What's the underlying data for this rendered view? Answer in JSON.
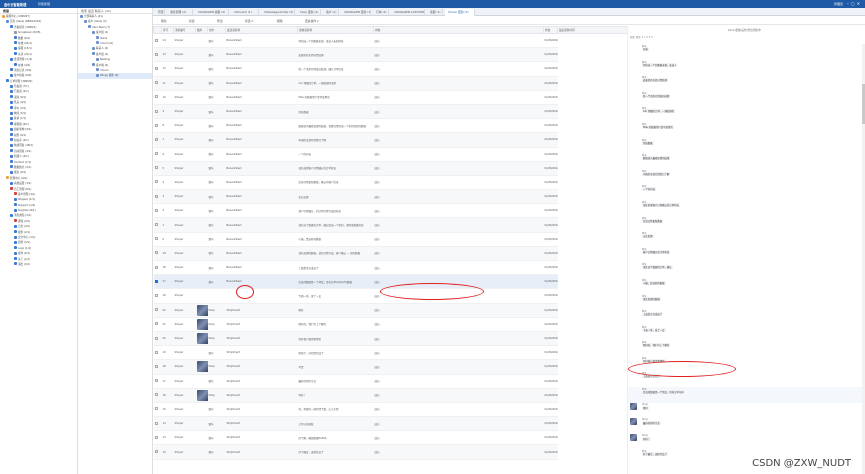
{
  "app": {
    "title": "金尔云智能助理",
    "subtitle": "智能助理",
    "user": "管理员"
  },
  "left": {
    "header": "客服",
    "nodes": [
      {
        "label": "客服中心 (1380/67)",
        "color": "#e8a33a",
        "indent": 0
      },
      {
        "label": "买家 (Vaus) (6869/1234)",
        "color": "#5a8dd6",
        "indent": 1
      },
      {
        "label": "咨询接待 (2068/1)",
        "color": "#3c78d8",
        "indent": 2
      },
      {
        "label": "Scrapbook (40/8)",
        "color": "#999",
        "indent": 3
      },
      {
        "label": "数据 (6/1)",
        "color": "#3c78d8",
        "indent": 3
      },
      {
        "label": "在线 (42/1)",
        "color": "#3c78d8",
        "indent": 3
      },
      {
        "label": "客服 (13/1)",
        "color": "#3c78d8",
        "indent": 3
      },
      {
        "label": "关注 (41/1)",
        "color": "#3c78d8",
        "indent": 3
      },
      {
        "label": "会话管理 (4 /4)",
        "color": "#3c78d8",
        "indent": 2
      },
      {
        "label": "在线 (4/4)",
        "color": "#3c78d8",
        "indent": 3
      },
      {
        "label": "消息记录 (0/0)",
        "color": "#3c78d8",
        "indent": 2
      },
      {
        "label": "客户档案 (6/0)",
        "color": "#3c78d8",
        "indent": 2
      },
      {
        "label": "订单管理 (3960/9)",
        "color": "#3c78d8",
        "indent": 1
      },
      {
        "label": "待发货 (7/1)",
        "color": "#3c78d8",
        "indent": 2
      },
      {
        "label": "已发货 (2/1)",
        "color": "#3c78d8",
        "indent": 2
      },
      {
        "label": "退款 (6/1)",
        "color": "#3c78d8",
        "indent": 2
      },
      {
        "label": "售后 (4/1)",
        "color": "#3c78d8",
        "indent": 2
      },
      {
        "label": "评价 (3/1)",
        "color": "#3c78d8",
        "indent": 2
      },
      {
        "label": "物流 (5/1)",
        "color": "#3c78d8",
        "indent": 2
      },
      {
        "label": "投诉 (1/1)",
        "color": "#3c78d8",
        "indent": 2
      },
      {
        "label": "客服组 (6/1)",
        "color": "#3c78d8",
        "indent": 2
      },
      {
        "label": "组织架构 (9/1)",
        "color": "#3c78d8",
        "indent": 2
      },
      {
        "label": "权限 (6/1)",
        "color": "#3c78d8",
        "indent": 2
      },
      {
        "label": "知识库 (4/1)",
        "color": "#3c78d8",
        "indent": 2
      },
      {
        "label": "快捷回复 (48/1)",
        "color": "#3c78d8",
        "indent": 2
      },
      {
        "label": "自动回复 (4/1)",
        "color": "#3c78d8",
        "indent": 2
      },
      {
        "label": "机器人 (4/1)",
        "color": "#3c78d8",
        "indent": 2
      },
      {
        "label": "Contact (7/1)",
        "color": "#3c78d8",
        "indent": 2
      },
      {
        "label": "数据统计 (2/1)",
        "color": "#3c78d8",
        "indent": 2
      },
      {
        "label": "报表 (9/1)",
        "color": "#3c78d8",
        "indent": 2
      },
      {
        "label": "管理中心 (6/1)",
        "color": "#e8a33a",
        "indent": 1
      },
      {
        "label": "系统设置 (3/1)",
        "color": "#3c78d8",
        "indent": 2
      },
      {
        "label": "员工管理 (8/1)",
        "color": "#d83c3c",
        "indent": 2
      },
      {
        "label": "客户管理 (4/1)",
        "color": "#d83c3c",
        "indent": 3
      },
      {
        "label": "Shipper (1/1)",
        "color": "#3c78d8",
        "indent": 3
      },
      {
        "label": "Support (1/2)",
        "color": "#3c78d8",
        "indent": 3
      },
      {
        "label": "Supplier (6/1)",
        "color": "#3c78d8",
        "indent": 3
      },
      {
        "label": "消息通知 (2/1)",
        "color": "#3c78d8",
        "indent": 2
      },
      {
        "label": "通知 (4/1)",
        "color": "#d83c3c",
        "indent": 3
      },
      {
        "label": "日志 (4/1)",
        "color": "#3c78d8",
        "indent": 3
      },
      {
        "label": "备份 (2/1)",
        "color": "#3c78d8",
        "indent": 3
      },
      {
        "label": "安全中心 (1/1)",
        "color": "#3c78d8",
        "indent": 3
      },
      {
        "label": "更新 (5/1)",
        "color": "#3c78d8",
        "indent": 3
      },
      {
        "label": "Logo (1/1)",
        "color": "#3c78d8",
        "indent": 3
      },
      {
        "label": "插件 (6/1)",
        "color": "#3c78d8",
        "indent": 3
      },
      {
        "label": "关于 (2/1)",
        "color": "#3c78d8",
        "indent": 3
      },
      {
        "label": "退出 (0/1)",
        "color": "#3c78d8",
        "indent": 3
      }
    ]
  },
  "mid": {
    "header": "搜索  最近  联系人  (41)",
    "nodes": [
      {
        "label": "全部联系人 (41)",
        "indent": 0
      },
      {
        "label": "客户 (Vaus) (2)",
        "indent": 1
      },
      {
        "label": "Cars Team (7)",
        "indent": 2
      },
      {
        "label": "客户组 (2)",
        "indent": 3
      },
      {
        "label": "Ibaris",
        "indent": 4
      },
      {
        "label": "Vroom (6)",
        "indent": 4
      },
      {
        "label": "联系人 (4)",
        "indent": 3
      },
      {
        "label": "客户组 (2)",
        "indent": 3
      },
      {
        "label": "Nexting",
        "indent": 4
      },
      {
        "label": "客户端 (4)",
        "indent": 3
      },
      {
        "label": "Vroom",
        "indent": 4
      },
      {
        "label": "Wings 更新 (0)",
        "indent": 4
      }
    ],
    "selected": 11
  },
  "tabs": [
    "首页",
    "消息管理 (4)",
    "VOLWAGEN 客服 (2)",
    "VolCoach (1)",
    "VolkswagenOrder (5)",
    "Shop 更新 (2)",
    "客户 (1)",
    "VOLWAGEN 更新 (3)",
    "订单 (2)",
    "VOLWAGEN CUSTOMS (2)",
    "客服 (1)",
    "Vroom 更新 (3)"
  ],
  "toolbar": [
    "刷新",
    "新建",
    "导出",
    "筛选 ▾",
    "删除",
    "更多操作 ▾"
  ],
  "grid": {
    "headers": [
      "",
      "序号",
      "消息编号",
      "图片",
      "用户",
      "发送者名称",
      "接收者名称",
      "内容",
      "状态",
      "最后更新时间"
    ],
    "rows": [
      {
        "n": "14",
        "id": "Shoper",
        "img": false,
        "from": "赛车",
        "to": "BanersTeam",
        "content": "你的这一个的数据来源。发送人未知消息",
        "status": "成功",
        "time": "01/06/2022 17:48:03"
      },
      {
        "n": "13",
        "id": "Shoper",
        "img": false,
        "from": "赛车",
        "to": "BanersTeam",
        "content": "表面带的东西已经处理",
        "status": "成功",
        "time": "01/06/2022 17:48:03"
      },
      {
        "n": "12",
        "id": "Shoper",
        "img": false,
        "from": "赛车",
        "to": "BanersTeam",
        "content": "给一个请求已经成功处理。确认订单信息",
        "status": "成功",
        "time": "01/06/2022 17:48:03"
      },
      {
        "n": "11",
        "id": "Shoper",
        "img": false,
        "from": "赛车",
        "to": "BanersTeam",
        "content": "Car 测量的订单，一键处理的请求",
        "status": "成功",
        "time": "01/06/2022 17:48:03"
      },
      {
        "n": "10",
        "id": "Shoper",
        "img": false,
        "from": "赛车",
        "to": "BanersTeam",
        "content": "Map 的数据用户是可使用的",
        "status": "成功",
        "time": "01/06/2022 17:48:03"
      },
      {
        "n": "9",
        "id": "Shoper",
        "img": false,
        "from": "赛车",
        "to": "BanersTeam",
        "content": "消息数据",
        "status": "成功",
        "time": "01/06/2022 17:48:03"
      },
      {
        "n": "8",
        "id": "Shoper",
        "img": false,
        "from": "赛车",
        "to": "BanersTeam",
        "content": "数据显示最终处理的结果，查看已经添加一个新的消息的数据",
        "status": "成功",
        "time": "01/06/2022 17:48:03"
      },
      {
        "n": "7",
        "id": "Shoper",
        "img": false,
        "from": "赛车",
        "to": "BanersTeam",
        "content": "中国的全部已经是已了解",
        "status": "成功",
        "time": "01/06/2022 17:48:03"
      },
      {
        "n": "6",
        "id": "Shoper",
        "img": false,
        "from": "赛车",
        "to": "BanersTeam",
        "content": "一个的内容",
        "status": "成功",
        "time": "01/06/2022 17:48:03"
      },
      {
        "n": "5",
        "id": "Shoper",
        "img": false,
        "from": "赛车",
        "to": "BanersTeam",
        "content": "请在处理客户已经确认的订单状态",
        "status": "成功",
        "time": "01/06/2022 17:48:03"
      },
      {
        "n": "4",
        "id": "Shoper",
        "img": false,
        "from": "赛车",
        "to": "BanersTeam",
        "content": "信息已经更新数据，确认的客户信息",
        "status": "成功",
        "time": "01/06/2022 17:48:03"
      },
      {
        "n": "3",
        "id": "Shoper",
        "img": false,
        "from": "赛车",
        "to": "BanersTeam",
        "content": "正在处理",
        "status": "成功",
        "time": "01/06/2022 17:48:03"
      },
      {
        "n": "2",
        "id": "Shoper",
        "img": false,
        "from": "赛车",
        "to": "BanersTeam",
        "content": "客户已经确认，的订单已经完成的状态",
        "status": "成功",
        "time": "01/06/2022 17:48:03"
      },
      {
        "n": "1",
        "id": "Shoper",
        "img": false,
        "from": "赛车",
        "to": "BanersTeam",
        "content": "请在这个数据的订单，确认给出一个新的，请检查数据状态",
        "status": "成功",
        "time": "01/06/2022 17:48:03"
      },
      {
        "n": "0",
        "id": "Shoper",
        "img": false,
        "from": "赛车",
        "to": "BanersTeam",
        "content": "小猫，是这些的数据",
        "status": "成功",
        "time": "01/06/2022 17:48:03"
      },
      {
        "n": "19",
        "id": "Shoper",
        "img": false,
        "from": "赛车",
        "to": "BanersTeam",
        "content": "请在处理的数据，请在已经完成，客户确认 — 实际数据",
        "status": "成功",
        "time": "01/06/2022 17:48:03"
      },
      {
        "n": "18",
        "id": "Shoper",
        "img": false,
        "from": "赛车",
        "to": "BanersTeam",
        "content": "上面是正在发送了",
        "status": "成功",
        "time": "01/06/2022 17:48:03"
      },
      {
        "n": "17",
        "id": "Shoper",
        "img": false,
        "from": "赛车",
        "to": "BanersTeam",
        "content": "信息的数据是一个测试，带有订单号码(2/5)数据",
        "status": "成功",
        "time": "01/06/2022 17:48:03",
        "hl": true
      },
      {
        "n": "16",
        "id": "Shoper",
        "img": false,
        "from": "",
        "to": "",
        "content": "下面一条，发了一会",
        "status": "成功",
        "time": "01/06/2022 17:48:03"
      },
      {
        "n": "22",
        "id": "Shoper",
        "img": true,
        "from": "Shop",
        "to": "StripSmart",
        "content": "嗯好",
        "status": "成功",
        "time": "01/06/2022 17:48:03"
      },
      {
        "n": "21",
        "id": "Shoper",
        "img": true,
        "from": "Shop",
        "to": "StripSmart",
        "content": "嗯好的，我们马上了解的",
        "status": "成功",
        "time": "01/06/2022 17:48:03"
      },
      {
        "n": "20",
        "id": "Shoper",
        "img": true,
        "from": "Shop",
        "to": "StripSmart",
        "content": "你好客户很需要经验",
        "status": "成功",
        "time": "01/06/2022 17:48:03"
      },
      {
        "n": "19",
        "id": "Shoper",
        "img": false,
        "from": "赛车",
        "to": "StripSmart",
        "content": "而现了，好已经完成了",
        "status": "成功",
        "time": "01/06/2022 17:48:03"
      },
      {
        "n": "18",
        "id": "Shoper",
        "img": true,
        "from": "Shop",
        "to": "StripSmart",
        "content": "不是",
        "status": "成功",
        "time": "01/06/2022 17:48:03"
      },
      {
        "n": "17",
        "id": "Shoper",
        "img": false,
        "from": "赛车",
        "to": "StripSmart",
        "content": "最好的你的专业",
        "status": "成功",
        "time": "01/06/2022 17:48:03"
      },
      {
        "n": "16",
        "id": "Shoper",
        "img": true,
        "from": "Shop",
        "to": "StripSmart",
        "content": "你好！",
        "status": "成功",
        "time": "01/06/2022 17:48:03"
      },
      {
        "n": "15",
        "id": "Shoper",
        "img": false,
        "from": "赛车",
        "to": "StripSmart",
        "content": "你，需要的一键已经了数，太大东西",
        "status": "成功",
        "time": "01/06/2022 17:48:03"
      },
      {
        "n": "14",
        "id": "Shoper",
        "img": false,
        "from": "赛车",
        "to": "StripSmart",
        "content": "让可以的获取",
        "status": "成功",
        "time": "01/06/2022 17:48:03"
      },
      {
        "n": "13",
        "id": "Shoper",
        "img": false,
        "from": "赛车",
        "to": "StripSmart",
        "content": "好了解，确保数据NoSQL",
        "status": "成功",
        "time": "01/06/2022 17:48:03"
      },
      {
        "n": "12",
        "id": "Shoper",
        "img": false,
        "from": "赛车",
        "to": "StripSmart",
        "content": "好了确定，选择作品了",
        "status": "成功",
        "time": "01/06/2022 17:48:03"
      }
    ]
  },
  "chat": {
    "header": "Coca 更新(后台)导出消息中",
    "top": "刷新  搜索  1  2  3  4  5",
    "messages": [
      {
        "who": "赛车",
        "time": "01/06/2022 17:48",
        "text": "开始",
        "av": false
      },
      {
        "who": "赛车",
        "time": "01/06/2022 17:48",
        "text": "你的这一个的数据来源。发送人",
        "av": false
      },
      {
        "who": "赛车",
        "time": "01/06/2022 17:48",
        "text": "表面带的东西已经处理",
        "av": false
      },
      {
        "who": "赛车",
        "time": "01/06/2022 17:48",
        "text": "给一个请求已经成功处理",
        "av": false
      },
      {
        "who": "赛车",
        "time": "01/06/2022 17:48",
        "text": "Car 测量的订单，一键处理的",
        "av": false
      },
      {
        "who": "赛车",
        "time": "01/06/2022 17:48",
        "text": "Map 的数据用户是可使用的",
        "av": false
      },
      {
        "who": "赛车",
        "time": "01/06/2022 17:48",
        "text": "消息数据",
        "av": false
      },
      {
        "who": "赛车",
        "time": "01/06/2022 17:48",
        "text": "数据显示最终处理的结果",
        "av": false
      },
      {
        "who": "赛车",
        "time": "01/06/2022 17:48",
        "text": "中国的全部已经是已了解",
        "av": false
      },
      {
        "who": "赛车",
        "time": "01/06/2022 17:48",
        "text": "一个的内容",
        "av": false
      },
      {
        "who": "赛车",
        "time": "01/06/2022 17:48",
        "text": "请在处理客户已经确认的订单状态",
        "av": false
      },
      {
        "who": "赛车",
        "time": "01/06/2022 17:48",
        "text": "信息已经更新数据",
        "av": false
      },
      {
        "who": "赛车",
        "time": "01/06/2022 17:48",
        "text": "正在处理",
        "av": false
      },
      {
        "who": "赛车",
        "time": "01/06/2022 17:48",
        "text": "客户已经确认的订单状态",
        "av": false
      },
      {
        "who": "赛车",
        "time": "01/06/2022 17:48",
        "text": "请在这个数据的订单，确认",
        "av": false
      },
      {
        "who": "赛车",
        "time": "01/06/2022 17:48",
        "text": "小猫，是这些的数据",
        "av": false
      },
      {
        "who": "赛车",
        "time": "01/06/2022 17:48",
        "text": "请在处理的数据",
        "av": false
      },
      {
        "who": "赛车",
        "time": "01/06/2022 17:48",
        "text": "上面是正在发送了",
        "av": false
      },
      {
        "who": "赛车",
        "time": "01/06/2022 17:48",
        "text": "下面一条，发了一会",
        "av": false
      },
      {
        "who": "赛车",
        "time": "01/06/2022 17:48",
        "text": "嗯好的，我们马上了解的",
        "av": false
      },
      {
        "who": "赛车",
        "time": "01/06/2022 17:48",
        "text": "你好客户很需要经验",
        "av": false
      },
      {
        "who": "赛车",
        "time": "01/06/2022 17:48",
        "text": "上面显示已经了",
        "av": false
      },
      {
        "who": "赛车",
        "time": "01/06/2022 17:48",
        "text": "信息的数据是一个测试，带有订单号码",
        "av": false,
        "hl": true
      },
      {
        "who": "Shop",
        "time": "01/06/2022 17:48",
        "text": "嗯好",
        "av": true
      },
      {
        "who": "Shop",
        "time": "01/06/2022 17:48",
        "text": "最好的你的专业",
        "av": true
      },
      {
        "who": "Shop",
        "time": "01/06/2022 17:48",
        "text": "你好！",
        "av": true
      },
      {
        "who": "赛车",
        "time": "01/06/2022 17:48",
        "text": "好了确定，选择作品了",
        "av": false
      }
    ]
  },
  "watermark": "CSDN @ZXW_NUDT",
  "colors": {
    "brand": "#1e5aa6",
    "highlight": "#e02020"
  }
}
